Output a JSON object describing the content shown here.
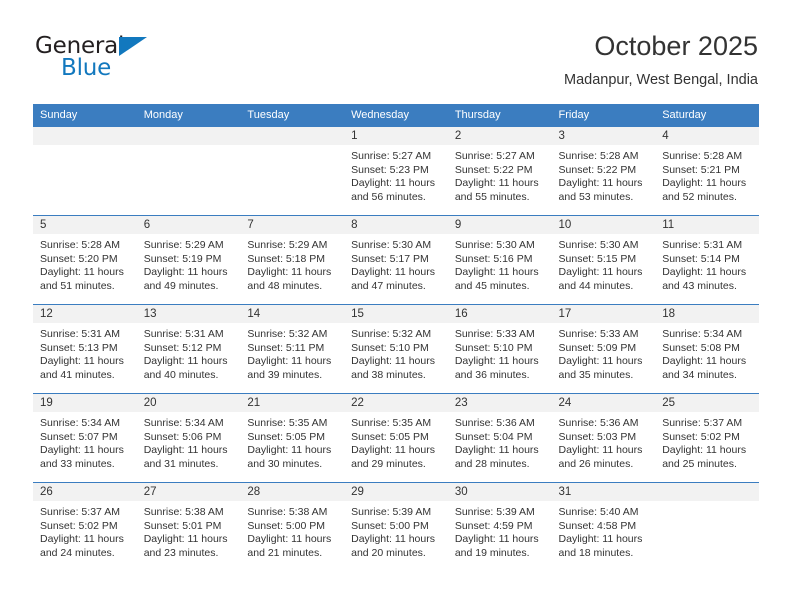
{
  "brand": {
    "name_part1": "General",
    "name_part2": "Blue",
    "logo_icon": "triangle-icon",
    "accent_color": "#1278be"
  },
  "header": {
    "title": "October 2025",
    "subtitle": "Madanpur, West Bengal, India"
  },
  "theme": {
    "header_blue": "#3b7dc0",
    "daynum_gray": "#f2f2f2",
    "text": "#333333"
  },
  "calendar": {
    "month": "October",
    "year": "2025",
    "weekday_headers": [
      "Sunday",
      "Monday",
      "Tuesday",
      "Wednesday",
      "Thursday",
      "Friday",
      "Saturday"
    ],
    "weeks": [
      [
        {
          "day": "",
          "sunrise": "",
          "sunset": "",
          "daylight_line1": "",
          "daylight_line2": ""
        },
        {
          "day": "",
          "sunrise": "",
          "sunset": "",
          "daylight_line1": "",
          "daylight_line2": ""
        },
        {
          "day": "",
          "sunrise": "",
          "sunset": "",
          "daylight_line1": "",
          "daylight_line2": ""
        },
        {
          "day": "1",
          "sunrise": "Sunrise: 5:27 AM",
          "sunset": "Sunset: 5:23 PM",
          "daylight_line1": "Daylight: 11 hours",
          "daylight_line2": "and 56 minutes."
        },
        {
          "day": "2",
          "sunrise": "Sunrise: 5:27 AM",
          "sunset": "Sunset: 5:22 PM",
          "daylight_line1": "Daylight: 11 hours",
          "daylight_line2": "and 55 minutes."
        },
        {
          "day": "3",
          "sunrise": "Sunrise: 5:28 AM",
          "sunset": "Sunset: 5:22 PM",
          "daylight_line1": "Daylight: 11 hours",
          "daylight_line2": "and 53 minutes."
        },
        {
          "day": "4",
          "sunrise": "Sunrise: 5:28 AM",
          "sunset": "Sunset: 5:21 PM",
          "daylight_line1": "Daylight: 11 hours",
          "daylight_line2": "and 52 minutes."
        }
      ],
      [
        {
          "day": "5",
          "sunrise": "Sunrise: 5:28 AM",
          "sunset": "Sunset: 5:20 PM",
          "daylight_line1": "Daylight: 11 hours",
          "daylight_line2": "and 51 minutes."
        },
        {
          "day": "6",
          "sunrise": "Sunrise: 5:29 AM",
          "sunset": "Sunset: 5:19 PM",
          "daylight_line1": "Daylight: 11 hours",
          "daylight_line2": "and 49 minutes."
        },
        {
          "day": "7",
          "sunrise": "Sunrise: 5:29 AM",
          "sunset": "Sunset: 5:18 PM",
          "daylight_line1": "Daylight: 11 hours",
          "daylight_line2": "and 48 minutes."
        },
        {
          "day": "8",
          "sunrise": "Sunrise: 5:30 AM",
          "sunset": "Sunset: 5:17 PM",
          "daylight_line1": "Daylight: 11 hours",
          "daylight_line2": "and 47 minutes."
        },
        {
          "day": "9",
          "sunrise": "Sunrise: 5:30 AM",
          "sunset": "Sunset: 5:16 PM",
          "daylight_line1": "Daylight: 11 hours",
          "daylight_line2": "and 45 minutes."
        },
        {
          "day": "10",
          "sunrise": "Sunrise: 5:30 AM",
          "sunset": "Sunset: 5:15 PM",
          "daylight_line1": "Daylight: 11 hours",
          "daylight_line2": "and 44 minutes."
        },
        {
          "day": "11",
          "sunrise": "Sunrise: 5:31 AM",
          "sunset": "Sunset: 5:14 PM",
          "daylight_line1": "Daylight: 11 hours",
          "daylight_line2": "and 43 minutes."
        }
      ],
      [
        {
          "day": "12",
          "sunrise": "Sunrise: 5:31 AM",
          "sunset": "Sunset: 5:13 PM",
          "daylight_line1": "Daylight: 11 hours",
          "daylight_line2": "and 41 minutes."
        },
        {
          "day": "13",
          "sunrise": "Sunrise: 5:31 AM",
          "sunset": "Sunset: 5:12 PM",
          "daylight_line1": "Daylight: 11 hours",
          "daylight_line2": "and 40 minutes."
        },
        {
          "day": "14",
          "sunrise": "Sunrise: 5:32 AM",
          "sunset": "Sunset: 5:11 PM",
          "daylight_line1": "Daylight: 11 hours",
          "daylight_line2": "and 39 minutes."
        },
        {
          "day": "15",
          "sunrise": "Sunrise: 5:32 AM",
          "sunset": "Sunset: 5:10 PM",
          "daylight_line1": "Daylight: 11 hours",
          "daylight_line2": "and 38 minutes."
        },
        {
          "day": "16",
          "sunrise": "Sunrise: 5:33 AM",
          "sunset": "Sunset: 5:10 PM",
          "daylight_line1": "Daylight: 11 hours",
          "daylight_line2": "and 36 minutes."
        },
        {
          "day": "17",
          "sunrise": "Sunrise: 5:33 AM",
          "sunset": "Sunset: 5:09 PM",
          "daylight_line1": "Daylight: 11 hours",
          "daylight_line2": "and 35 minutes."
        },
        {
          "day": "18",
          "sunrise": "Sunrise: 5:34 AM",
          "sunset": "Sunset: 5:08 PM",
          "daylight_line1": "Daylight: 11 hours",
          "daylight_line2": "and 34 minutes."
        }
      ],
      [
        {
          "day": "19",
          "sunrise": "Sunrise: 5:34 AM",
          "sunset": "Sunset: 5:07 PM",
          "daylight_line1": "Daylight: 11 hours",
          "daylight_line2": "and 33 minutes."
        },
        {
          "day": "20",
          "sunrise": "Sunrise: 5:34 AM",
          "sunset": "Sunset: 5:06 PM",
          "daylight_line1": "Daylight: 11 hours",
          "daylight_line2": "and 31 minutes."
        },
        {
          "day": "21",
          "sunrise": "Sunrise: 5:35 AM",
          "sunset": "Sunset: 5:05 PM",
          "daylight_line1": "Daylight: 11 hours",
          "daylight_line2": "and 30 minutes."
        },
        {
          "day": "22",
          "sunrise": "Sunrise: 5:35 AM",
          "sunset": "Sunset: 5:05 PM",
          "daylight_line1": "Daylight: 11 hours",
          "daylight_line2": "and 29 minutes."
        },
        {
          "day": "23",
          "sunrise": "Sunrise: 5:36 AM",
          "sunset": "Sunset: 5:04 PM",
          "daylight_line1": "Daylight: 11 hours",
          "daylight_line2": "and 28 minutes."
        },
        {
          "day": "24",
          "sunrise": "Sunrise: 5:36 AM",
          "sunset": "Sunset: 5:03 PM",
          "daylight_line1": "Daylight: 11 hours",
          "daylight_line2": "and 26 minutes."
        },
        {
          "day": "25",
          "sunrise": "Sunrise: 5:37 AM",
          "sunset": "Sunset: 5:02 PM",
          "daylight_line1": "Daylight: 11 hours",
          "daylight_line2": "and 25 minutes."
        }
      ],
      [
        {
          "day": "26",
          "sunrise": "Sunrise: 5:37 AM",
          "sunset": "Sunset: 5:02 PM",
          "daylight_line1": "Daylight: 11 hours",
          "daylight_line2": "and 24 minutes."
        },
        {
          "day": "27",
          "sunrise": "Sunrise: 5:38 AM",
          "sunset": "Sunset: 5:01 PM",
          "daylight_line1": "Daylight: 11 hours",
          "daylight_line2": "and 23 minutes."
        },
        {
          "day": "28",
          "sunrise": "Sunrise: 5:38 AM",
          "sunset": "Sunset: 5:00 PM",
          "daylight_line1": "Daylight: 11 hours",
          "daylight_line2": "and 21 minutes."
        },
        {
          "day": "29",
          "sunrise": "Sunrise: 5:39 AM",
          "sunset": "Sunset: 5:00 PM",
          "daylight_line1": "Daylight: 11 hours",
          "daylight_line2": "and 20 minutes."
        },
        {
          "day": "30",
          "sunrise": "Sunrise: 5:39 AM",
          "sunset": "Sunset: 4:59 PM",
          "daylight_line1": "Daylight: 11 hours",
          "daylight_line2": "and 19 minutes."
        },
        {
          "day": "31",
          "sunrise": "Sunrise: 5:40 AM",
          "sunset": "Sunset: 4:58 PM",
          "daylight_line1": "Daylight: 11 hours",
          "daylight_line2": "and 18 minutes."
        },
        {
          "day": "",
          "sunrise": "",
          "sunset": "",
          "daylight_line1": "",
          "daylight_line2": ""
        }
      ]
    ]
  }
}
